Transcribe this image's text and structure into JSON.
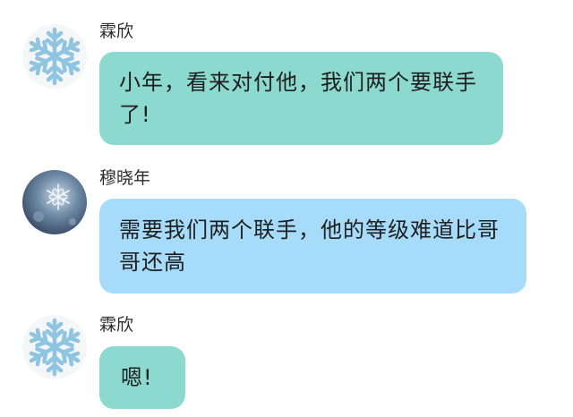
{
  "messages": [
    {
      "sender": "霖欣",
      "avatar_icon": "snowflake-icon",
      "bubble_color": "#8cd9cf",
      "text": "小年，看来对付他，我们两个要联手了!"
    },
    {
      "sender": "穆晓年",
      "avatar_icon": "frost-photo-avatar",
      "bubble_color": "#a6dcfa",
      "text": "需要我们两个联手，他的等级难道比哥哥还高"
    },
    {
      "sender": "霖欣",
      "avatar_icon": "snowflake-icon",
      "bubble_color": "#8cd9cf",
      "text": "嗯!"
    }
  ]
}
